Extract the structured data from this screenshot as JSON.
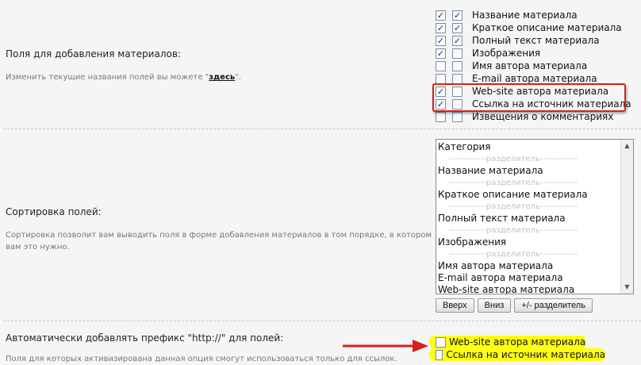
{
  "section_fields": {
    "title": "Поля для добавления материалов:",
    "hint_before": "Изменить текущие названия полей вы можете \"",
    "hint_link": "здесь",
    "hint_after": "\".",
    "items": [
      {
        "label": "Название материала",
        "left_checked": true,
        "right_checked": true
      },
      {
        "label": "Краткое описание материала",
        "left_checked": true,
        "right_checked": true
      },
      {
        "label": "Полный текст материала",
        "left_checked": true,
        "right_checked": true
      },
      {
        "label": "Изображения",
        "left_checked": true,
        "right_checked": false
      },
      {
        "label": "Имя автора материала",
        "left_checked": false,
        "right_checked": false
      },
      {
        "label": "E-mail автора материала",
        "left_checked": false,
        "right_checked": false
      },
      {
        "label": "Web-site автора материала",
        "left_checked": true,
        "right_checked": false
      },
      {
        "label": "Ссылка на источник материала",
        "left_checked": true,
        "right_checked": false
      },
      {
        "label": "Извещения о комментариях",
        "left_checked": false,
        "right_checked": false
      }
    ]
  },
  "section_sort": {
    "title": "Сортировка полей:",
    "hint": "Сортировка позволит вам выводить поля в форме добавления материалов в том порядке, в котором вам это нужно.",
    "list": [
      {
        "text": "Категория",
        "sep": false
      },
      {
        "text": "-------------разделитель-------------",
        "sep": true
      },
      {
        "text": "Название материала",
        "sep": false
      },
      {
        "text": "-------------разделитель-------------",
        "sep": true
      },
      {
        "text": "Краткое описание материала",
        "sep": false
      },
      {
        "text": "-------------разделитель-------------",
        "sep": true
      },
      {
        "text": "Полный текст материала",
        "sep": false
      },
      {
        "text": "-------------разделитель-------------",
        "sep": true
      },
      {
        "text": "Изображения",
        "sep": false
      },
      {
        "text": "-------------разделитель-------------",
        "sep": true
      },
      {
        "text": "Имя автора материала",
        "sep": false
      },
      {
        "text": "E-mail автора материала",
        "sep": false
      },
      {
        "text": "Web-site автора материала",
        "sep": false
      }
    ],
    "buttons": {
      "up": "Вверх",
      "down": "Вниз",
      "separator": "+/- разделитель"
    }
  },
  "section_prefix": {
    "title": "Автоматически добавлять префикс \"http://\" для полей:",
    "hint": "Поля для которых активизирована данная опция смогут использоваться только для ссылок.",
    "items": [
      {
        "label": "Web-site автора материала",
        "checked": false
      },
      {
        "label": "Ссылка на источник материала",
        "checked": false
      }
    ]
  },
  "colors": {
    "highlight_box": "#d8201a",
    "highlight_marker": "#ffff10",
    "arrow": "#d8201a"
  }
}
